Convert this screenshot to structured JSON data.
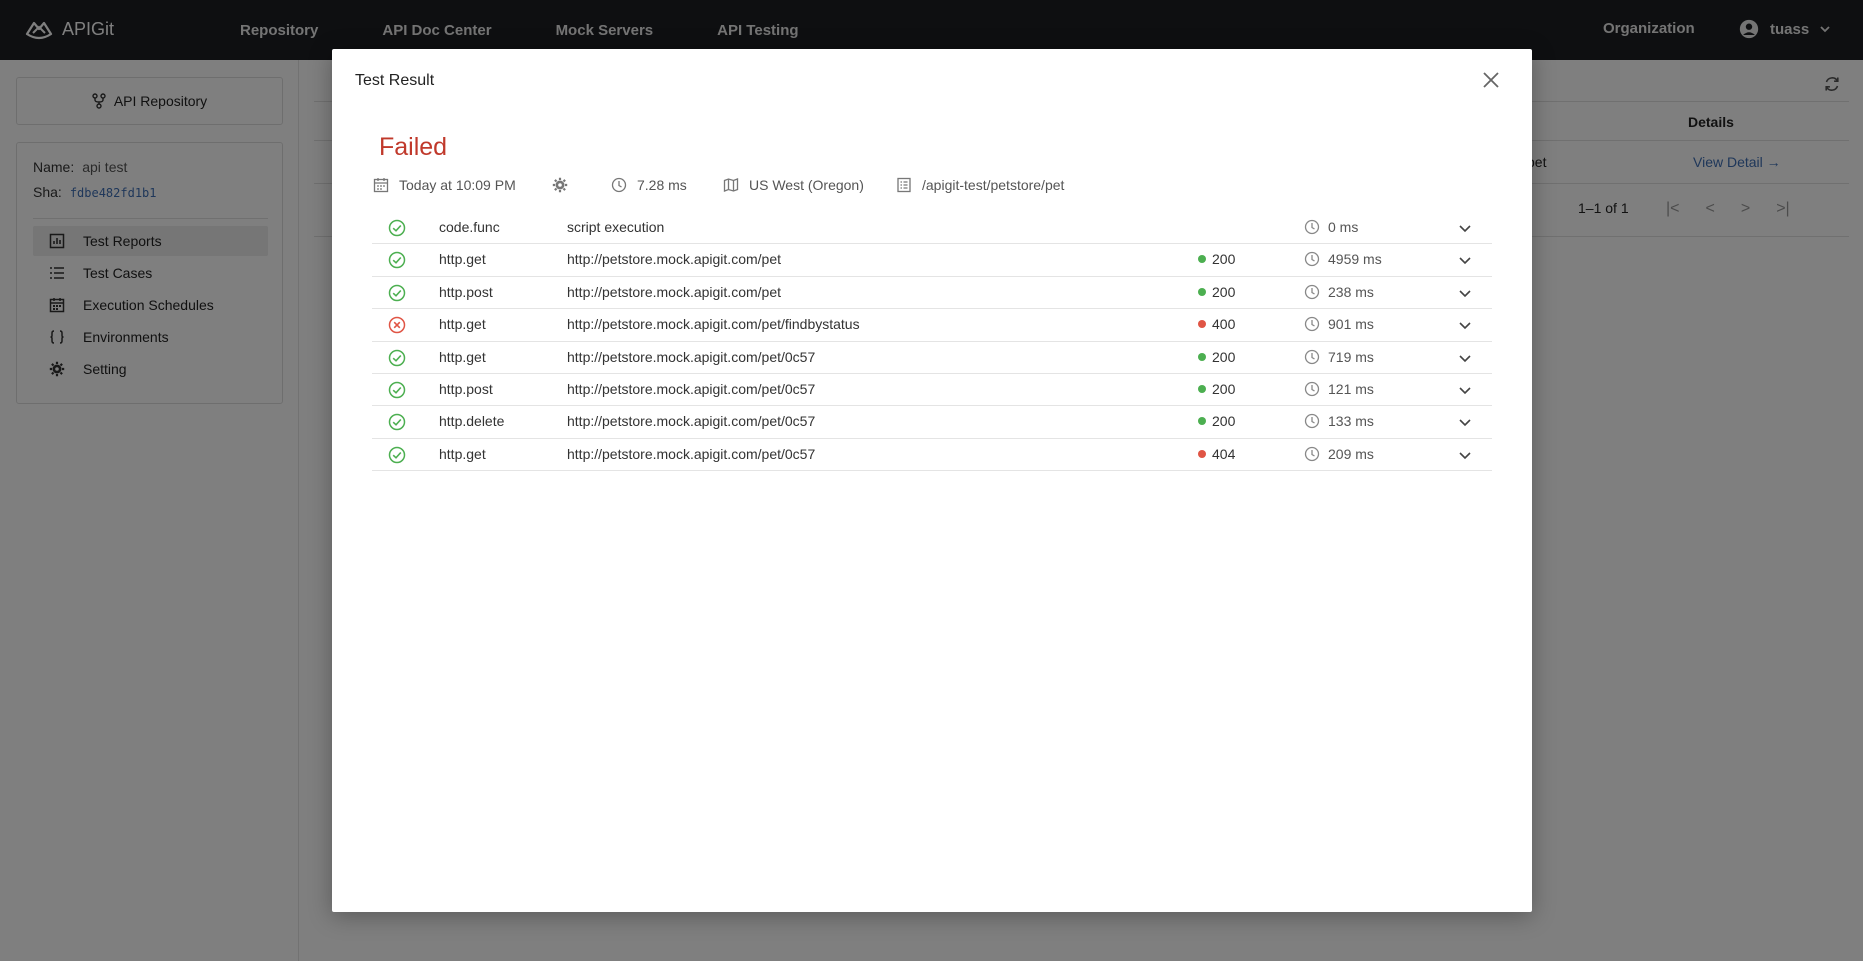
{
  "app": {
    "name": "APIGit"
  },
  "nav": {
    "items": [
      "Repository",
      "API Doc Center",
      "Mock Servers",
      "API Testing"
    ],
    "organization": "Organization",
    "user": "tuass"
  },
  "sidebar": {
    "repo_button": "API Repository",
    "name_label": "Name:",
    "name_value": "api test",
    "sha_label": "Sha:",
    "sha_value": "fdbe482fd1b1",
    "menu": [
      {
        "label": "Test Reports",
        "icon": "chart-icon",
        "active": true
      },
      {
        "label": "Test Cases",
        "icon": "list-icon",
        "active": false
      },
      {
        "label": "Execution Schedules",
        "icon": "calendar-icon",
        "active": false
      },
      {
        "label": "Environments",
        "icon": "braces-icon",
        "active": false
      },
      {
        "label": "Setting",
        "icon": "gear-icon",
        "active": false
      }
    ]
  },
  "background": {
    "details_header": "Details",
    "row_path_fragment": "pet",
    "view_detail": "View Detail",
    "pagination": "1–1 of 1"
  },
  "modal": {
    "title": "Test Result",
    "status": "Failed",
    "status_color": "#c0392b",
    "meta": {
      "date": "Today at 10:09 PM",
      "duration": "7.28 ms",
      "region": "US West (Oregon)",
      "path": "/apigit-test/petstore/pet"
    },
    "rows": [
      {
        "ok": true,
        "type": "code.func",
        "target": "script execution",
        "code": "",
        "time": "0 ms"
      },
      {
        "ok": true,
        "type": "http.get",
        "target": "http://petstore.mock.apigit.com/pet",
        "code": "200",
        "time": "4959 ms"
      },
      {
        "ok": true,
        "type": "http.post",
        "target": "http://petstore.mock.apigit.com/pet",
        "code": "200",
        "time": "238 ms"
      },
      {
        "ok": false,
        "type": "http.get",
        "target": "http://petstore.mock.apigit.com/pet/findbystatus",
        "code": "400",
        "time": "901 ms"
      },
      {
        "ok": true,
        "type": "http.get",
        "target": "http://petstore.mock.apigit.com/pet/0c57",
        "code": "200",
        "time": "719 ms"
      },
      {
        "ok": true,
        "type": "http.post",
        "target": "http://petstore.mock.apigit.com/pet/0c57",
        "code": "200",
        "time": "121 ms"
      },
      {
        "ok": true,
        "type": "http.delete",
        "target": "http://petstore.mock.apigit.com/pet/0c57",
        "code": "200",
        "time": "133 ms"
      },
      {
        "ok": true,
        "type": "http.get",
        "target": "http://petstore.mock.apigit.com/pet/0c57",
        "code": "404",
        "time": "209 ms"
      }
    ]
  },
  "colors": {
    "success": "#4caf50",
    "error": "#e05545",
    "link": "#3f6fb4"
  }
}
